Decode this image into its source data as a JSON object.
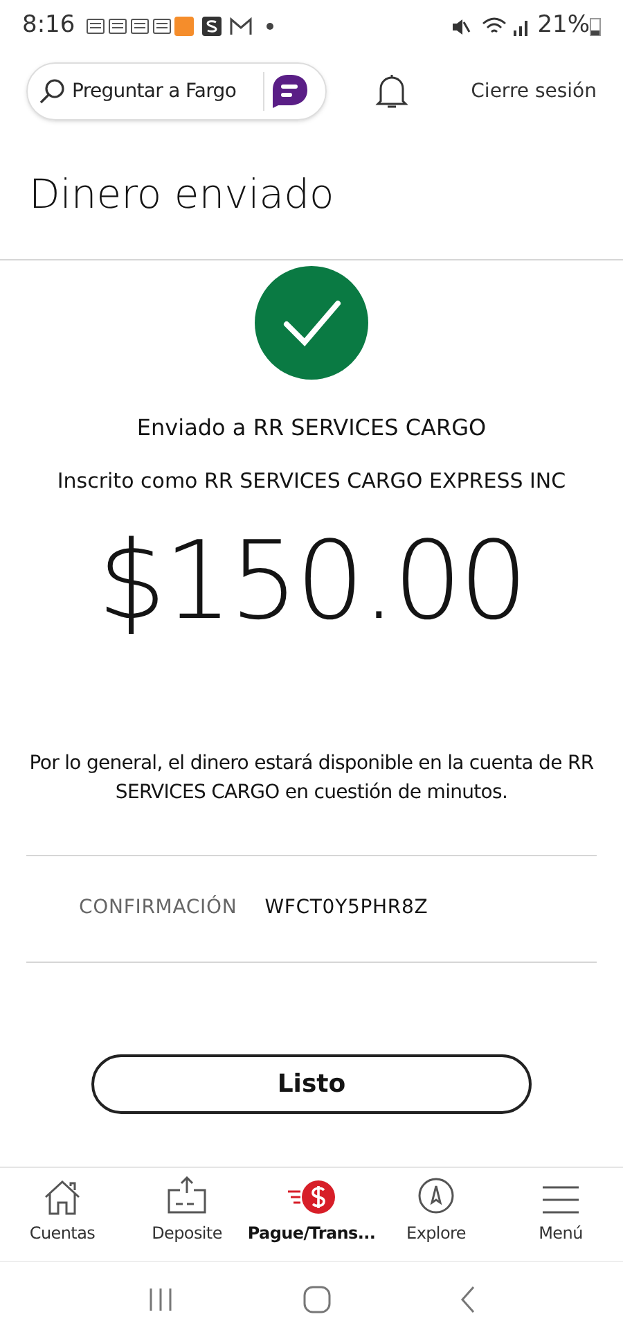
{
  "status_bar": {
    "time": "8:16",
    "battery": "21%"
  },
  "header": {
    "search": {
      "placeholder": "Preguntar a Fargo"
    },
    "logout": "Cierre sesión"
  },
  "title": "Dinero enviado",
  "recipient": "Enviado a RR SERVICES CARGO",
  "enrolled_as": "Inscrito como RR SERVICES CARGO EXPRESS INC",
  "amount": "$150.00",
  "note": "Por lo general, el dinero estará disponible en la cuenta de RR SERVICES CARGO en cuestión de minutos.",
  "confirmation": {
    "label": "CONFIRMACIÓN",
    "value": "WFCT0Y5PHR8Z"
  },
  "done_button": "Listo",
  "bottom_nav": [
    {
      "kind": "home",
      "label": "Cuentas",
      "selected": false
    },
    {
      "kind": "deposit",
      "label": "Deposite",
      "selected": false
    },
    {
      "kind": "pay",
      "label": "Pague/Trans...",
      "selected": true
    },
    {
      "kind": "explore",
      "label": "Explore",
      "selected": false
    },
    {
      "kind": "menu",
      "label": "Menú",
      "selected": false
    }
  ]
}
